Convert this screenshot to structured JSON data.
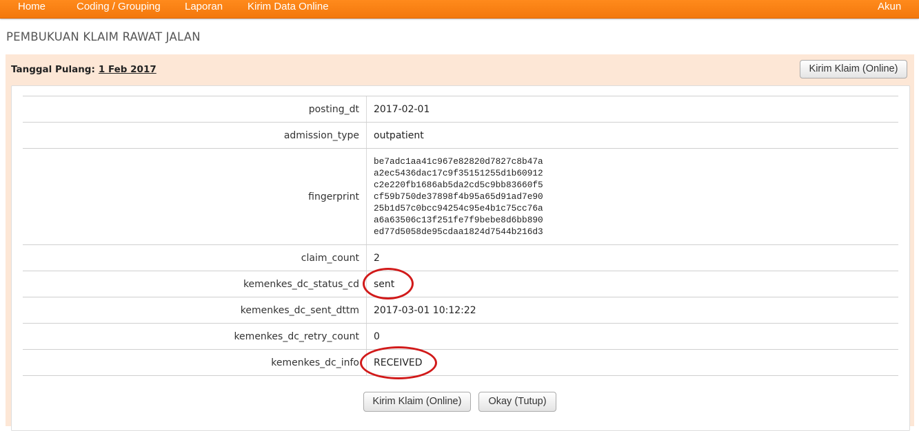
{
  "nav": {
    "items": [
      "Home",
      "Coding / Grouping",
      "Laporan",
      "Kirim Data Online"
    ],
    "account": "Akun"
  },
  "page": {
    "title": "PEMBUKUAN KLAIM RAWAT JALAN"
  },
  "header": {
    "date_label": "Tanggal Pulang:",
    "date_value": "1 Feb 2017",
    "send_button": "Kirim Klaim (Online)"
  },
  "table": {
    "rows": [
      {
        "key": "posting_dt",
        "value": "2017-02-01"
      },
      {
        "key": "admission_type",
        "value": "outpatient"
      },
      {
        "key": "fingerprint",
        "value_lines": [
          "be7adc1aa41c967e82820d7827c8b47a",
          "a2ec5436dac17c9f35151255d1b60912",
          "c2e220fb1686ab5da2cd5c9bb83660f5",
          "cf59b750de37898f4b95a65d91ad7e90",
          "25b1d57c0bcc94254c95e4b1c75cc76a",
          "a6a63506c13f251fe7f9bebe8d6bb890",
          "ed77d5058de95cdaa1824d7544b216d3"
        ]
      },
      {
        "key": "claim_count",
        "value": "2"
      },
      {
        "key": "kemenkes_dc_status_cd",
        "value": "sent"
      },
      {
        "key": "kemenkes_dc_sent_dttm",
        "value": "2017-03-01 10:12:22"
      },
      {
        "key": "kemenkes_dc_retry_count",
        "value": "0"
      },
      {
        "key": "kemenkes_dc_info",
        "value": "RECEIVED"
      }
    ]
  },
  "footer": {
    "send_button": "Kirim Klaim (Online)",
    "ok_button": "Okay (Tutup)"
  },
  "annotation": {
    "color": "#d11a1a"
  }
}
